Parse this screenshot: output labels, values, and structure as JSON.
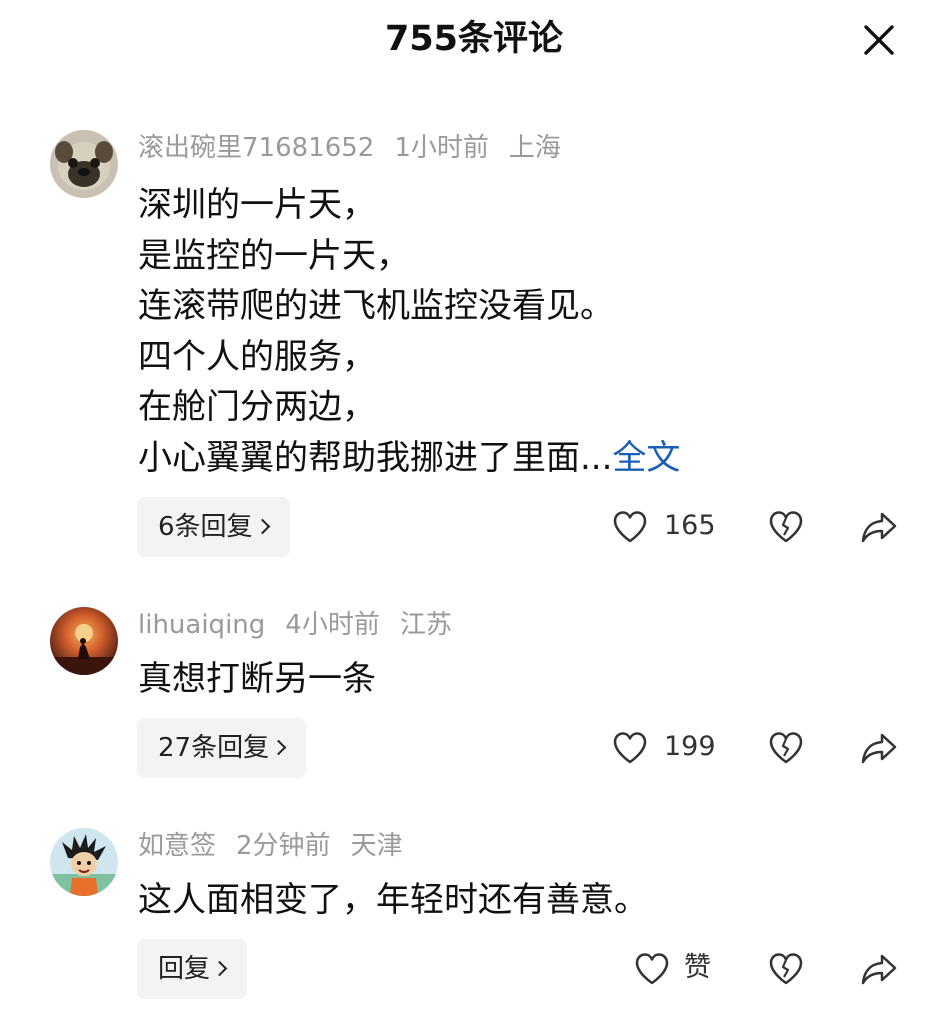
{
  "header": {
    "title": "755条评论",
    "close_icon": "close-icon"
  },
  "comments": [
    {
      "username": "滚出碗里71681652",
      "time": "1小时前",
      "location": "上海",
      "avatar": "pug-avatar",
      "lines": [
        "深圳的一片天，",
        "是监控的一片天，",
        "连滚带爬的进飞机监控没看见。",
        "四个人的服务，",
        "在舱门分两边，",
        "小心翼翼的帮助我挪进了里面..."
      ],
      "more_label": "全文",
      "reply_label": "6条回复",
      "like_count": "165"
    },
    {
      "username": "lihuaiqing",
      "time": "4小时前",
      "location": "江苏",
      "avatar": "sunset-rider-avatar",
      "lines": [
        "真想打断另一条"
      ],
      "reply_label": "27条回复",
      "like_count": "199"
    },
    {
      "username": "如意签",
      "time": "2分钟前",
      "location": "天津",
      "avatar": "cartoon-boy-avatar",
      "lines": [
        "这人面相变了，年轻时还有善意。"
      ],
      "reply_label": "回复",
      "like_count": "赞"
    }
  ],
  "icons": {
    "like": "heart-icon",
    "dislike": "broken-heart-icon",
    "share": "share-arrow-icon"
  },
  "colors": {
    "text": "#111111",
    "meta": "#9a9a9a",
    "link": "#1a5fb4",
    "pill_bg": "#f3f3f3"
  }
}
